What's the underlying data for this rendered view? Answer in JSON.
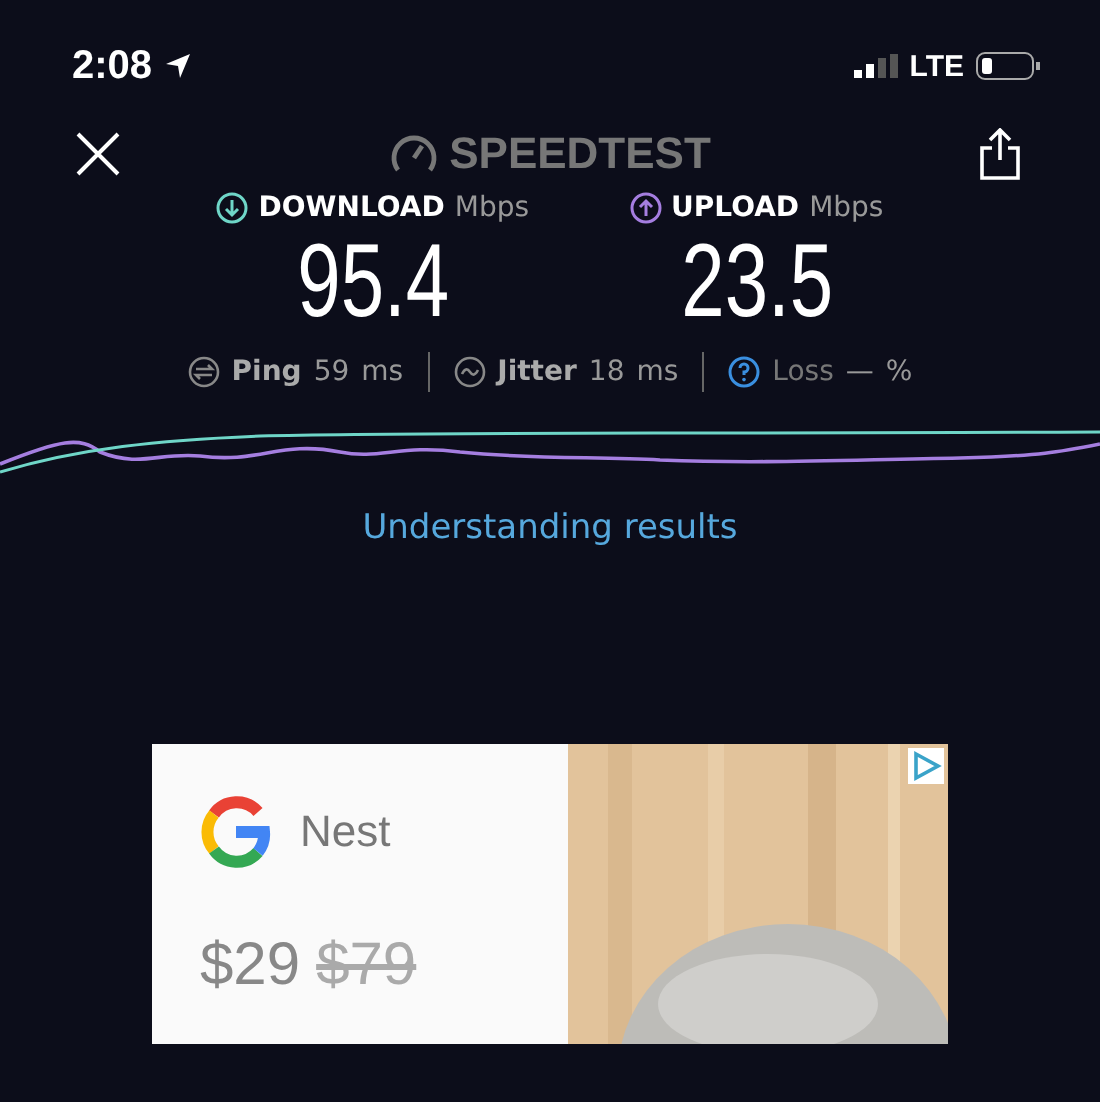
{
  "status_bar": {
    "time": "2:08",
    "network": "LTE"
  },
  "header": {
    "title": "SPEEDTEST"
  },
  "results": [
    {
      "kind": "download",
      "label": "DOWNLOAD",
      "unit": "Mbps",
      "value": "95.4",
      "color": "#6fd6c8"
    },
    {
      "kind": "upload",
      "label": "UPLOAD",
      "unit": "Mbps",
      "value": "23.5",
      "color": "#a57ee0"
    }
  ],
  "metrics": [
    {
      "kind": "ping",
      "label": "Ping",
      "value": "59",
      "unit": "ms"
    },
    {
      "kind": "jitter",
      "label": "Jitter",
      "value": "18",
      "unit": "ms"
    },
    {
      "kind": "loss",
      "label": "Loss",
      "value": "—",
      "unit": "%"
    }
  ],
  "link": "Understanding results",
  "ad": {
    "brand": "Nest",
    "price": "$29",
    "old_price": "$79"
  }
}
